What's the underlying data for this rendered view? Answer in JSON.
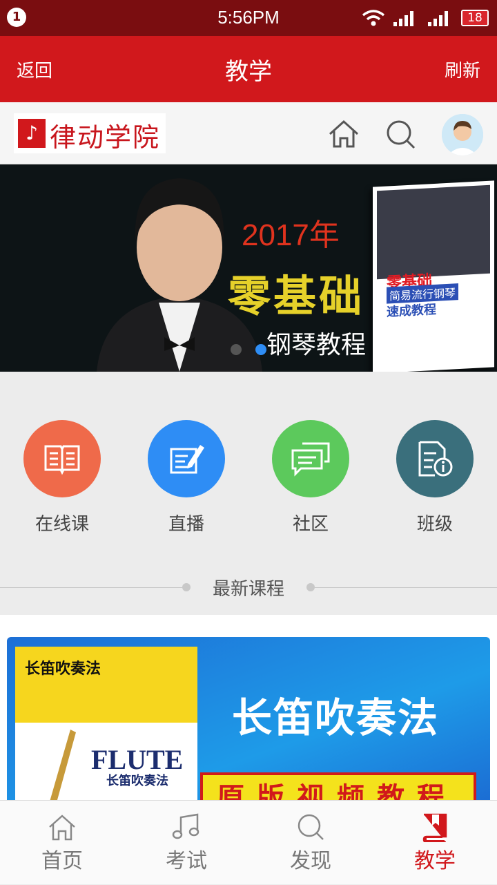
{
  "status_bar": {
    "notification_count": "1",
    "time": "5:56PM",
    "battery": "18"
  },
  "title_bar": {
    "back_label": "返回",
    "title": "教学",
    "refresh_label": "刷新"
  },
  "header": {
    "logo_text": "律动学院"
  },
  "banner": {
    "year_text": "2017年",
    "headline": "零基础",
    "subline": "钢琴教程",
    "book_title": "零基础",
    "book_subtitle": "简易流行钢琴",
    "book_subtitle2": "速成教程",
    "active_dot": 1
  },
  "quick_menu": [
    {
      "label": "在线课",
      "icon": "book-icon",
      "color": "#ef6a4a"
    },
    {
      "label": "直播",
      "icon": "edit-icon",
      "color": "#2e8df5"
    },
    {
      "label": "社区",
      "icon": "chat-icon",
      "color": "#5cc95c"
    },
    {
      "label": "班级",
      "icon": "class-info-icon",
      "color": "#3a6f7c"
    }
  ],
  "section": {
    "title": "最新课程"
  },
  "course": {
    "cover_title": "长笛吹奏法",
    "cover_english": "FLUTE",
    "cover_sub": "长笛吹奏法",
    "headline": "长笛吹奏法",
    "strip_text": "原版视频教程"
  },
  "tab_bar": [
    {
      "label": "首页",
      "icon": "home-icon"
    },
    {
      "label": "考试",
      "icon": "music-note-icon"
    },
    {
      "label": "发现",
      "icon": "search-icon"
    },
    {
      "label": "教学",
      "icon": "bookmark-book-icon",
      "active": true
    }
  ],
  "colors": {
    "primary": "#d1181c",
    "status_bar": "#7a0d10"
  }
}
